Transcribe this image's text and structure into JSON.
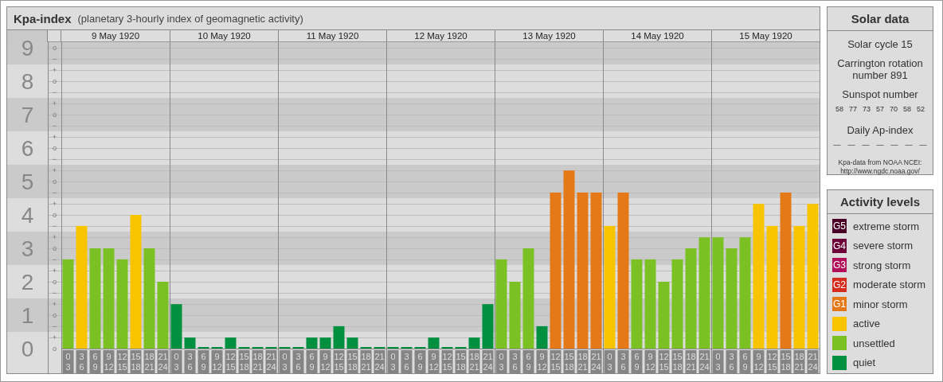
{
  "title": {
    "name": "Kpa-index",
    "subtitle": "(planetary 3-hourly index of geomagnetic activity)"
  },
  "dates": [
    "9 May 1920",
    "10 May 1920",
    "11 May 1920",
    "12 May 1920",
    "13 May 1920",
    "14 May 1920",
    "15 May 1920"
  ],
  "scale_marks": [
    "o",
    "−",
    "+",
    "o",
    "−",
    "+",
    "o",
    "−",
    "+",
    "o",
    "−",
    "+",
    "o",
    "−",
    "+",
    "o",
    "−",
    "+",
    "o",
    "−",
    "+",
    "o",
    "−",
    "+",
    "o",
    "−",
    "+",
    "o"
  ],
  "chart_data": {
    "type": "bar",
    "grid": true,
    "ylim": [
      0,
      9.17
    ],
    "yticks": [
      {
        "value": 0,
        "label": "0"
      },
      {
        "value": 1,
        "label": "1"
      },
      {
        "value": 2,
        "label": "2"
      },
      {
        "value": 3,
        "label": "3"
      },
      {
        "value": 4,
        "label": "4"
      },
      {
        "value": 5,
        "label": "5"
      },
      {
        "value": 6,
        "label": "6"
      },
      {
        "value": 7,
        "label": "7"
      },
      {
        "value": 8,
        "label": "8"
      },
      {
        "value": 9,
        "label": "9"
      }
    ],
    "categories": [
      "0 3",
      "3 6",
      "6 9",
      "9 12",
      "12 15",
      "15 18",
      "18 21",
      "21 24",
      "0 3",
      "3 6",
      "6 9",
      "9 12",
      "12 15",
      "15 18",
      "18 21",
      "21 24",
      "0 3",
      "3 6",
      "6 9",
      "9 12",
      "12 15",
      "15 18",
      "18 21",
      "21 24",
      "0 3",
      "3 6",
      "6 9",
      "9 12",
      "12 15",
      "15 18",
      "18 21",
      "21 24",
      "0 3",
      "3 6",
      "6 9",
      "9 12",
      "12 15",
      "15 18",
      "18 21",
      "21 24",
      "0 3",
      "3 6",
      "6 9",
      "9 12",
      "12 15",
      "15 18",
      "18 21",
      "21 24",
      "0 3",
      "3 6",
      "6 9",
      "9 12",
      "12 15",
      "15 18",
      "18 21",
      "21 24"
    ],
    "series": [
      {
        "color": "#009040",
        "values": [
          null,
          null,
          null,
          null,
          null,
          null,
          null,
          null,
          1.33,
          0.33,
          0,
          0,
          0.33,
          0,
          0,
          0,
          0,
          0,
          0.33,
          0.33,
          0.67,
          0.33,
          0,
          0,
          0,
          0,
          0,
          0.33,
          0,
          0,
          0.33,
          1.33,
          null,
          null,
          null,
          0.67,
          null,
          null,
          null,
          null,
          null,
          null,
          null,
          null,
          null,
          null,
          null,
          null,
          null,
          null,
          null,
          null,
          null,
          null,
          null,
          null
        ]
      },
      {
        "color": "#7bc124",
        "values": [
          2.67,
          null,
          3,
          3,
          2.67,
          null,
          3,
          2,
          null,
          null,
          null,
          null,
          null,
          null,
          null,
          null,
          null,
          null,
          null,
          null,
          null,
          null,
          null,
          null,
          null,
          null,
          null,
          null,
          null,
          null,
          null,
          null,
          2.67,
          2,
          3,
          null,
          null,
          null,
          null,
          null,
          null,
          null,
          2.67,
          2.67,
          2,
          2.67,
          3,
          3.33,
          3.33,
          3,
          3.33,
          null,
          null,
          null,
          null,
          null
        ]
      },
      {
        "color": "#f8c400",
        "values": [
          null,
          3.67,
          null,
          null,
          null,
          4,
          null,
          null,
          null,
          null,
          null,
          null,
          null,
          null,
          null,
          null,
          null,
          null,
          null,
          null,
          null,
          null,
          null,
          null,
          null,
          null,
          null,
          null,
          null,
          null,
          null,
          null,
          null,
          null,
          null,
          null,
          null,
          null,
          null,
          null,
          3.67,
          null,
          null,
          null,
          null,
          null,
          null,
          null,
          null,
          null,
          null,
          4.33,
          3.67,
          null,
          3.67,
          4.33
        ]
      },
      {
        "color": "#e57817",
        "values": [
          null,
          null,
          null,
          null,
          null,
          null,
          null,
          null,
          null,
          null,
          null,
          null,
          null,
          null,
          null,
          null,
          null,
          null,
          null,
          null,
          null,
          null,
          null,
          null,
          null,
          null,
          null,
          null,
          null,
          null,
          null,
          null,
          null,
          null,
          null,
          null,
          4.67,
          5.33,
          4.67,
          4.67,
          null,
          4.67,
          null,
          null,
          null,
          null,
          null,
          null,
          null,
          null,
          null,
          null,
          null,
          4.67,
          null,
          null
        ]
      }
    ]
  },
  "solar": {
    "title": "Solar data",
    "cycle": "Solar cycle 15",
    "rotation": "Carrington rotation number 891",
    "sunspot_title": "Sunspot number",
    "sunspots": [
      "58",
      "77",
      "73",
      "57",
      "70",
      "58",
      "52"
    ],
    "ap_title": "Daily Ap-index",
    "ap_values": [
      "—",
      "—",
      "—",
      "—",
      "—",
      "—",
      "—"
    ],
    "source": "Kpa-data from NOAA NCEI:",
    "source_url": "http://www.ngdc.noaa.gov/"
  },
  "legend": {
    "title": "Activity levels",
    "items": [
      {
        "code": "G5",
        "label": "extreme storm",
        "color": "#4a0026"
      },
      {
        "code": "G4",
        "label": "severe storm",
        "color": "#6c0038"
      },
      {
        "code": "G3",
        "label": "strong storm",
        "color": "#b0105a"
      },
      {
        "code": "G2",
        "label": "moderate storm",
        "color": "#d42d1e"
      },
      {
        "code": "G1",
        "label": "minor storm",
        "color": "#e57817"
      },
      {
        "label": "active",
        "color": "#f8c400"
      },
      {
        "label": "unsettled",
        "color": "#7bc124"
      },
      {
        "label": "quiet",
        "color": "#009040"
      }
    ]
  }
}
